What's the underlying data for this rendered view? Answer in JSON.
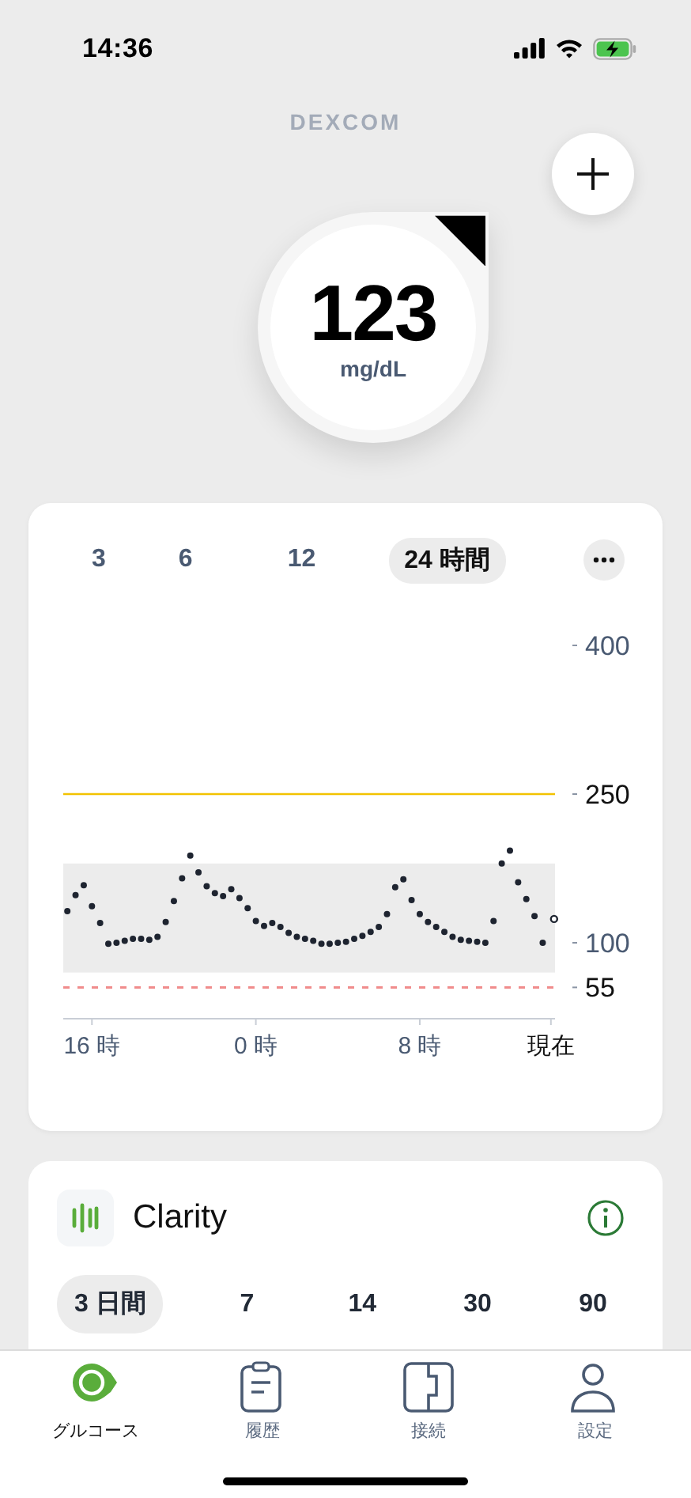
{
  "status_bar": {
    "time": "14:36"
  },
  "header": {
    "logo": "DEXCOM"
  },
  "reading": {
    "value": "123",
    "unit": "mg/dL"
  },
  "time_range_tabs": [
    {
      "label": "3",
      "selected": false
    },
    {
      "label": "6",
      "selected": false
    },
    {
      "label": "12",
      "selected": false
    },
    {
      "label": "24 時間",
      "selected": true
    }
  ],
  "chart": {
    "chart_data": {
      "type": "scatter",
      "categories": [
        null,
        null,
        null,
        "16 時",
        null,
        null,
        null,
        null,
        null,
        null,
        null,
        null,
        null,
        null,
        null,
        null,
        null,
        null,
        null,
        null,
        null,
        null,
        null,
        "0 時",
        null,
        null,
        null,
        null,
        null,
        null,
        null,
        null,
        null,
        null,
        null,
        null,
        null,
        null,
        null,
        null,
        null,
        null,
        null,
        "8 時",
        null,
        null,
        null,
        null,
        null,
        null,
        null,
        null,
        null,
        null,
        null,
        null,
        null,
        null,
        null,
        "現在"
      ],
      "series": [
        {
          "color": "#1e2430",
          "values": [
            132,
            148,
            158,
            137,
            120,
            99,
            100,
            102,
            104,
            104,
            103,
            106,
            121,
            142,
            165,
            188,
            171,
            157,
            150,
            147,
            154,
            145,
            135,
            122,
            117,
            120,
            116,
            110,
            106,
            104,
            102,
            99,
            99,
            100,
            101,
            104,
            107,
            111,
            116,
            129,
            156,
            164,
            143,
            129,
            121,
            116,
            111,
            106,
            103,
            102,
            101,
            100,
            122,
            180,
            193,
            161,
            144,
            127,
            100,
            124
          ]
        }
      ],
      "ylim": [
        25,
        400
      ],
      "yticks": [
        400,
        250,
        100,
        55
      ],
      "bands": [
        {
          "axis": "y",
          "from": 70,
          "to": 180
        }
      ],
      "ref_lines": [
        {
          "axis": "y",
          "value": 250
        },
        {
          "axis": "y",
          "value": 55
        }
      ]
    }
  },
  "clarity": {
    "title": "Clarity",
    "periods": [
      {
        "label": "3 日間",
        "selected": true
      },
      {
        "label": "7",
        "selected": false
      },
      {
        "label": "14",
        "selected": false
      },
      {
        "label": "30",
        "selected": false
      },
      {
        "label": "90",
        "selected": false
      }
    ]
  },
  "tab_bar": {
    "tabs": [
      {
        "label": "グルコース",
        "selected": true
      },
      {
        "label": "履歴",
        "selected": false
      },
      {
        "label": "接続",
        "selected": false
      },
      {
        "label": "設定",
        "selected": false
      }
    ]
  }
}
